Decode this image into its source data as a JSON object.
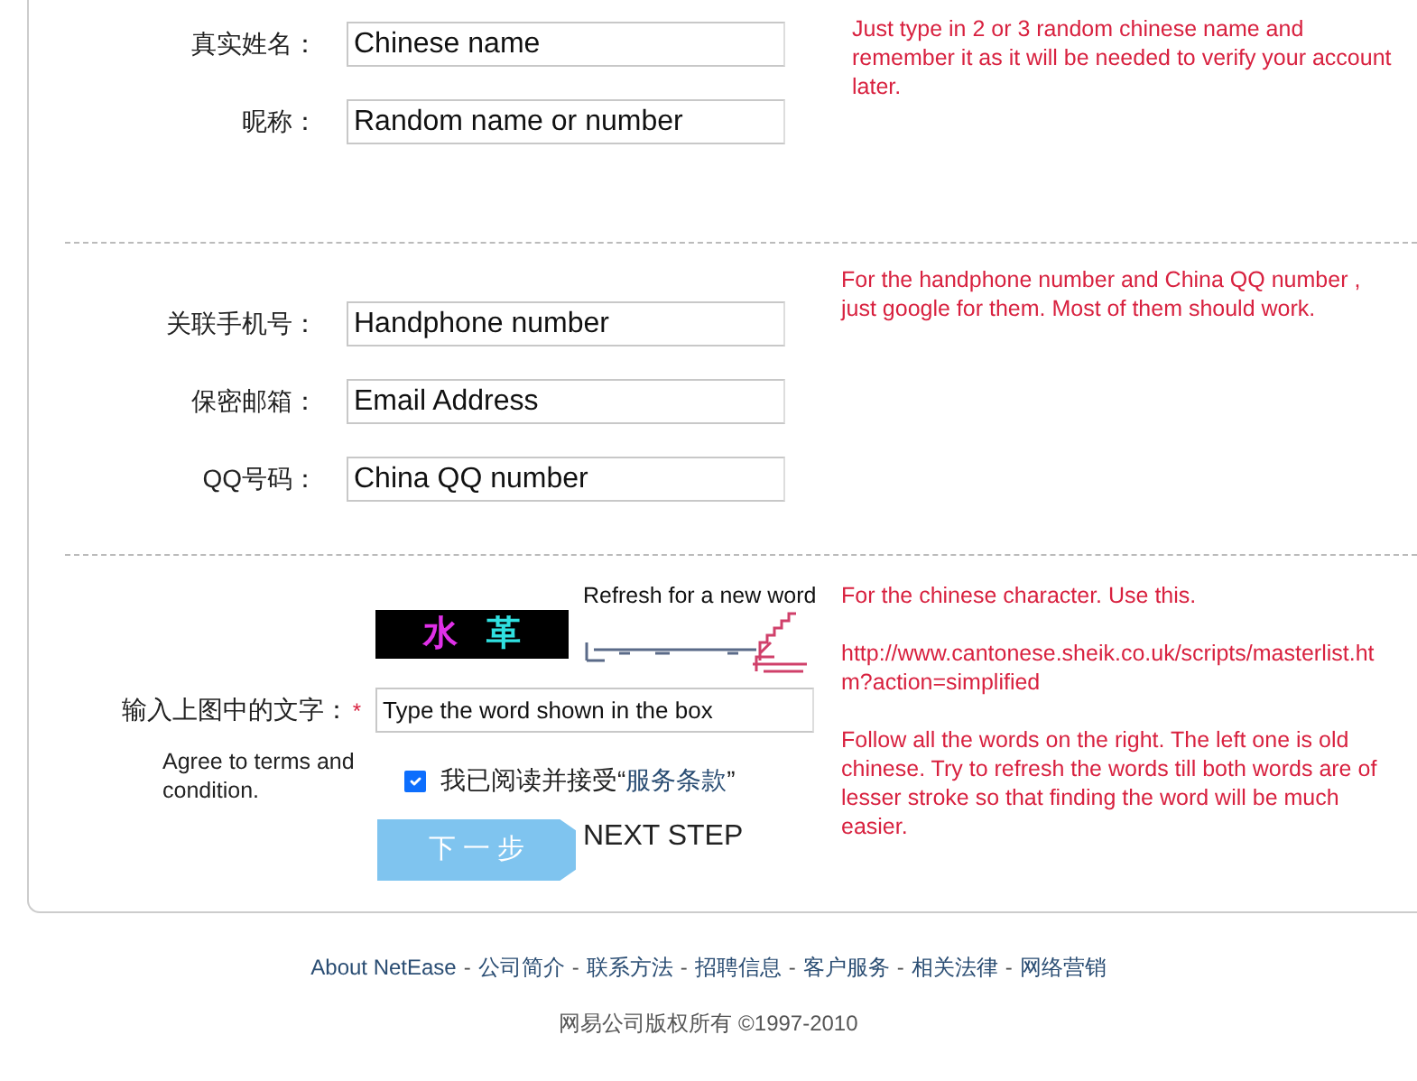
{
  "sections": [
    {
      "fields": [
        {
          "label": "真实姓名：",
          "value": "Chinese name"
        },
        {
          "label": "昵称：",
          "value": "Random name or number"
        }
      ],
      "notes": [
        "Just type in 2 or 3 random chinese name and remember it as it will be needed to verify your account later."
      ]
    },
    {
      "fields": [
        {
          "label": "关联手机号：",
          "value": "Handphone number"
        },
        {
          "label": "保密邮箱：",
          "value": "Email Address"
        },
        {
          "label": "QQ号码：",
          "value": "China QQ number"
        }
      ],
      "notes": [
        "For the handphone number and China QQ number , just google for them. Most of them should work."
      ]
    }
  ],
  "verify": {
    "refresh_text": "Refresh for a new word",
    "captcha": [
      {
        "char": "水",
        "color": "#e030e8"
      },
      {
        "char": "革",
        "color": "#30e0e0"
      }
    ],
    "label": "输入上图中的文字：",
    "required_mark": "*",
    "value": "Type the word shown in the box",
    "agree_note": "Agree to terms and condition.",
    "agree": {
      "checked": true,
      "text": "我已阅读并接受“",
      "link": "服务条款",
      "text_after": "”"
    },
    "button": "下 一 步",
    "button_note": "NEXT STEP",
    "notes": [
      "For the chinese character. Use this.",
      "http://www.cantonese.sheik.co.uk/scripts/masterlist.htm?action=simplified",
      "Follow all the words on the right. The left one is old chinese. Try to refresh the words till both words are of lesser stroke so that finding the word will be much easier."
    ]
  },
  "footer": {
    "links": [
      {
        "label": "About NetEase"
      },
      {
        "label": "公司简介",
        "separator": "-"
      },
      {
        "label": "联系方法",
        "separator": "-"
      },
      {
        "label": "招聘信息",
        "separator": "-"
      },
      {
        "label": "客户服务",
        "separator": "-"
      },
      {
        "label": "相关法律",
        "separator": "-"
      },
      {
        "label": "网络营销",
        "separator": "-"
      }
    ],
    "copyright": "网易公司版权所有 ©1997-2010"
  }
}
